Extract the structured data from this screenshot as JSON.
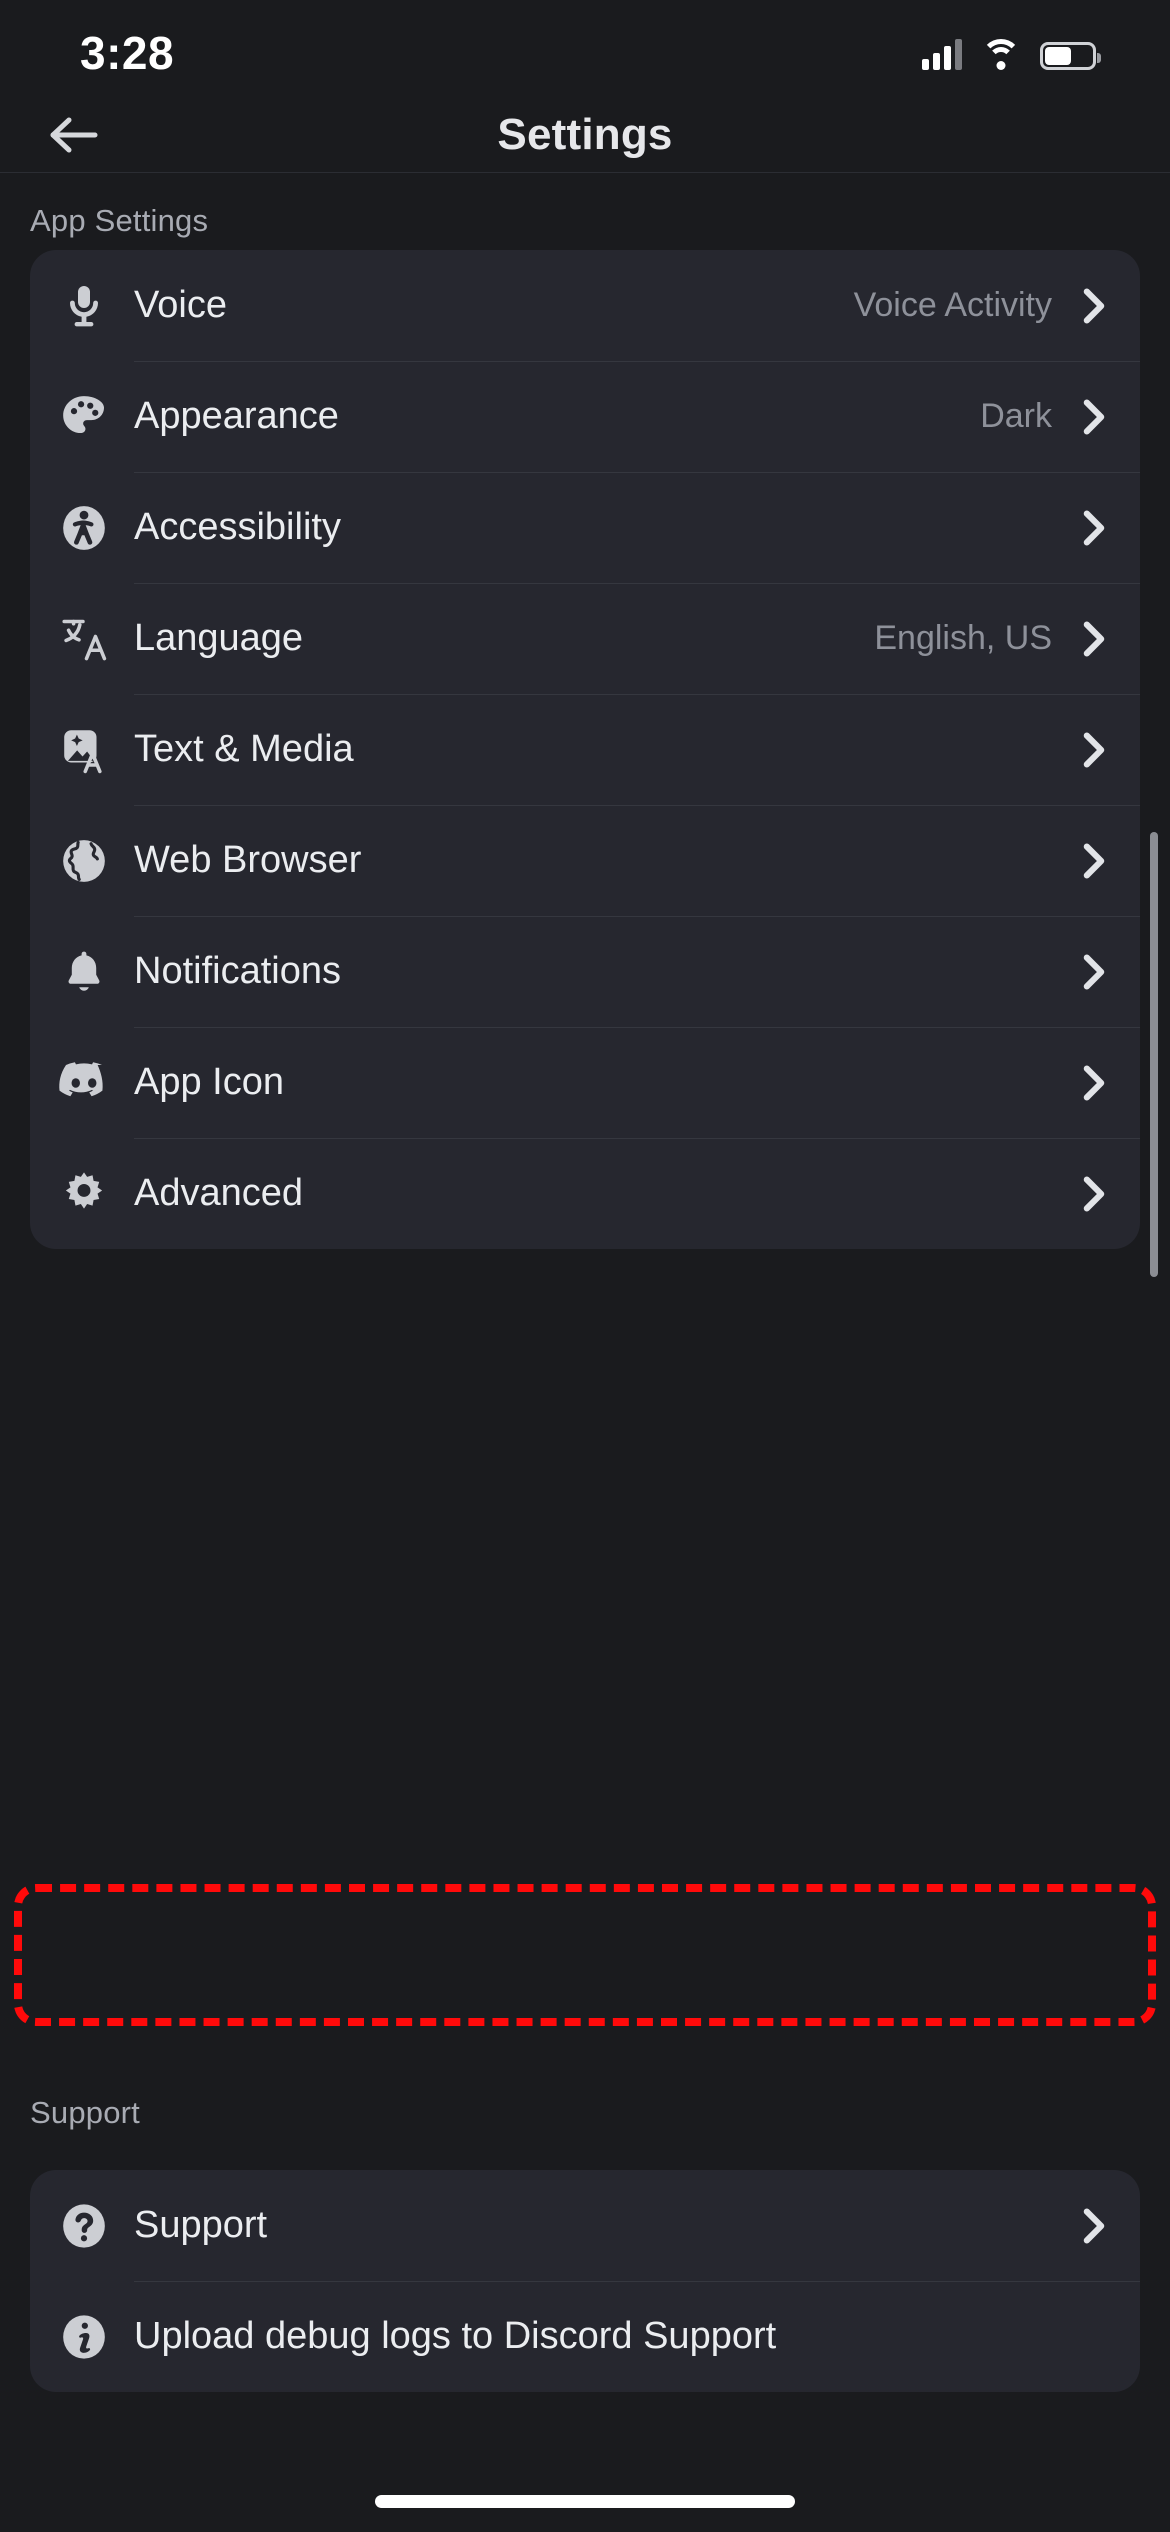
{
  "status_bar": {
    "time": "3:28",
    "signal_icon": "cellular-signal-icon",
    "wifi_icon": "wifi-icon",
    "battery_icon": "battery-icon"
  },
  "nav": {
    "back_icon": "back-arrow-icon",
    "title": "Settings"
  },
  "colors": {
    "page_background": "#1a1b1e",
    "card_background": "#26272f",
    "divider": "#35373f",
    "primary_text": "#ebedf0",
    "secondary_text": "#8e919a",
    "section_label": "#a8abb3",
    "highlight": "#ff0a0a",
    "scrollbar": "#8b8d93"
  },
  "sections": [
    {
      "label": "App Settings",
      "rows": [
        {
          "label": "Voice",
          "value": "Voice Activity",
          "icon": "microphone-icon",
          "chevron": "chevron-right-icon"
        },
        {
          "label": "Appearance",
          "value": "Dark",
          "icon": "palette-icon",
          "chevron": "chevron-right-icon"
        },
        {
          "label": "Accessibility",
          "value": "",
          "icon": "accessibility-icon",
          "chevron": "chevron-right-icon"
        },
        {
          "label": "Language",
          "value": "English, US",
          "icon": "translate-icon",
          "chevron": "chevron-right-icon"
        },
        {
          "label": "Text & Media",
          "value": "",
          "icon": "text-media-icon",
          "chevron": "chevron-right-icon"
        },
        {
          "label": "Web Browser",
          "value": "",
          "icon": "globe-icon",
          "chevron": "chevron-right-icon"
        },
        {
          "label": "Notifications",
          "value": "",
          "icon": "bell-icon",
          "chevron": "chevron-right-icon"
        },
        {
          "label": "App Icon",
          "value": "",
          "icon": "discord-logo-icon",
          "chevron": "chevron-right-icon"
        },
        {
          "label": "Advanced",
          "value": "",
          "icon": "gear-icon",
          "chevron": "chevron-right-icon"
        }
      ]
    },
    {
      "label": "Support",
      "rows": [
        {
          "label": "Support",
          "value": "",
          "icon": "question-circle-icon",
          "chevron": "chevron-right-icon"
        },
        {
          "label": "Upload debug logs to Discord Support",
          "value": "",
          "icon": "info-circle-icon",
          "chevron": ""
        }
      ]
    }
  ],
  "highlight": {
    "target_row_label": "Advanced"
  },
  "home_indicator": "home-indicator"
}
